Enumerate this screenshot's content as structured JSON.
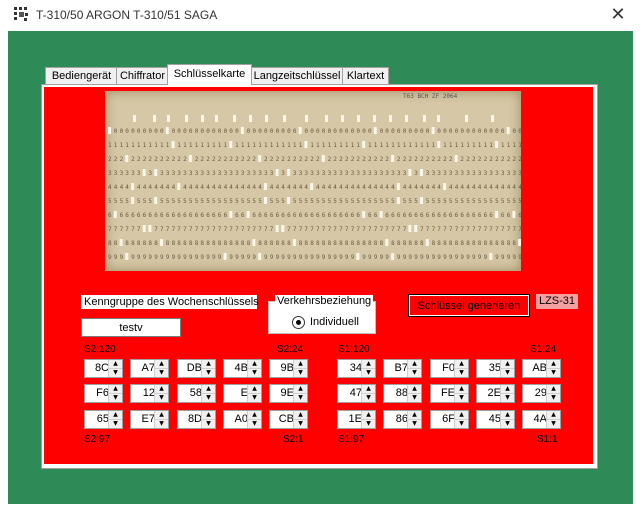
{
  "window": {
    "title": "T-310/50 ARGON T-310/51 SAGA",
    "close_glyph": "✕"
  },
  "tabs": [
    {
      "label": "Bediengerät",
      "active": false
    },
    {
      "label": "Chiffrator",
      "active": false
    },
    {
      "label": "Schlüsselkarte",
      "active": true
    },
    {
      "label": "Langzeitschlüssel",
      "active": false
    },
    {
      "label": "Klartext",
      "active": false
    }
  ],
  "card": {
    "header_text": "T63 BCH ZF 2064",
    "row_digits": [
      "0",
      "1",
      "2",
      "3",
      "4",
      "5",
      "6",
      "7",
      "8",
      "9"
    ]
  },
  "form": {
    "kenngruppe_label": "Kenngruppe des Wochenschlüssels",
    "kenngruppe_value": "testv",
    "verkehr_title": "Verkehrsbeziehung",
    "verkehr_option": "Individuell",
    "verkehr_selected": true,
    "generate_button": "Schlüssel generieren",
    "lzs_badge": "LZS-31"
  },
  "groups": {
    "s2": {
      "top_left": "S2:120",
      "top_right": "S2:24",
      "bottom_left": "S2:97",
      "bottom_right": "S2:1",
      "rows": [
        [
          "8C",
          "A7",
          "DB",
          "4B",
          "9B"
        ],
        [
          "F6",
          "12",
          "58",
          "E",
          "9E"
        ],
        [
          "65",
          "E7",
          "8D",
          "A0",
          "CB"
        ]
      ]
    },
    "s1": {
      "top_left": "S1:120",
      "top_right": "S1:24",
      "bottom_left": "S1:97",
      "bottom_right": "S1:1",
      "rows": [
        [
          "34",
          "B7",
          "F0",
          "35",
          "AB"
        ],
        [
          "47",
          "88",
          "FE",
          "2E",
          "29"
        ],
        [
          "1E",
          "86",
          "6F",
          "45",
          "4A"
        ]
      ]
    }
  },
  "colors": {
    "window_bg": "#2e8b57",
    "panel_red": "#ff0000",
    "card": "#d6c8a6",
    "badge": "#f4a0a0"
  }
}
